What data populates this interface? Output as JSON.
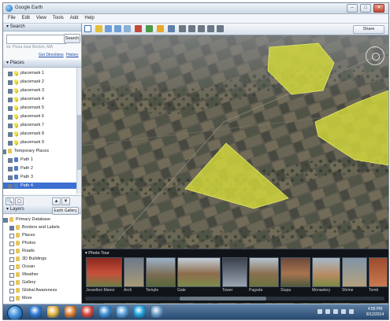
{
  "window": {
    "title": "Google Earth",
    "minimize_glyph": "–",
    "maximize_glyph": "□",
    "close_glyph": "✕"
  },
  "menubar": [
    "File",
    "Edit",
    "View",
    "Tools",
    "Add",
    "Help"
  ],
  "search": {
    "panel_title": "▾ Search",
    "button_label": "Search",
    "hint": "ex: Pizza near Boston, MA",
    "get_directions": "Get Directions",
    "history": "History"
  },
  "places": {
    "panel_title": "▾ Places",
    "items": [
      {
        "label": "placemark 1",
        "icon": "pushpin-icon"
      },
      {
        "label": "placemark 2",
        "icon": "pushpin-icon"
      },
      {
        "label": "placemark 3",
        "icon": "pushpin-icon"
      },
      {
        "label": "placemark 4",
        "icon": "pushpin-icon"
      },
      {
        "label": "placemark 5",
        "icon": "pushpin-icon"
      },
      {
        "label": "placemark 6",
        "icon": "pushpin-icon"
      },
      {
        "label": "placemark 7",
        "icon": "pushpin-icon"
      },
      {
        "label": "placemark 8",
        "icon": "pushpin-icon"
      },
      {
        "label": "placemark 9",
        "icon": "pushpin-icon"
      },
      {
        "label": "Temporary Places",
        "icon": "folder-icon"
      },
      {
        "label": "Path 1",
        "icon": "path-icon"
      },
      {
        "label": "Path 2",
        "icon": "path-icon"
      },
      {
        "label": "Path 3",
        "icon": "path-icon"
      },
      {
        "label": "Path 4",
        "icon": "path-icon",
        "selected": true
      }
    ],
    "tools": {
      "search_glyph": "🔍",
      "panel_glyph": "▢",
      "up_glyph": "▲",
      "down_glyph": "▼"
    }
  },
  "layers": {
    "panel_title": "▾ Layers",
    "gallery_button": "Earth Gallery »",
    "items": [
      {
        "label": "Primary Database",
        "on": true
      },
      {
        "label": "Borders and Labels",
        "on": true
      },
      {
        "label": "Places",
        "on": false
      },
      {
        "label": "Photos",
        "on": false
      },
      {
        "label": "Roads",
        "on": false
      },
      {
        "label": "3D Buildings",
        "on": false
      },
      {
        "label": "Ocean",
        "on": false
      },
      {
        "label": "Weather",
        "on": false
      },
      {
        "label": "Gallery",
        "on": false
      },
      {
        "label": "Global Awareness",
        "on": false
      },
      {
        "label": "More",
        "on": false
      }
    ]
  },
  "toolbar": {
    "share_label": "Share",
    "tools": [
      "sidebar-toggle-icon",
      "placemark-icon",
      "polygon-icon",
      "path-icon",
      "overlay-icon",
      "record-tour-icon",
      "historical-imagery-icon",
      "sun-icon",
      "planet-icon",
      "ruler-icon",
      "email-icon",
      "print-icon",
      "save-image-icon",
      "view-in-maps-icon"
    ]
  },
  "phototour": {
    "title": "▾ Photo Tour",
    "captions": [
      "Jesselton Manor",
      "Arch",
      "Temple",
      "Gate",
      "Tower",
      "Pagoda",
      "Stupa",
      "Monastery",
      "Shrine",
      "Tomb"
    ]
  },
  "taskbar": {
    "apps": [
      "internet-explorer-icon",
      "explorer-folder-icon",
      "media-player-icon",
      "chrome-icon",
      "google-earth-icon",
      "paint-icon",
      "skype-icon",
      "remote-desktop-icon"
    ],
    "clock": {
      "time": "4:58 PM",
      "date": "8/12/2014"
    }
  },
  "colors": {
    "polygon_fill": "#d3d93a",
    "selection": "#3c6fd1",
    "taskbar": "#2d5078"
  }
}
